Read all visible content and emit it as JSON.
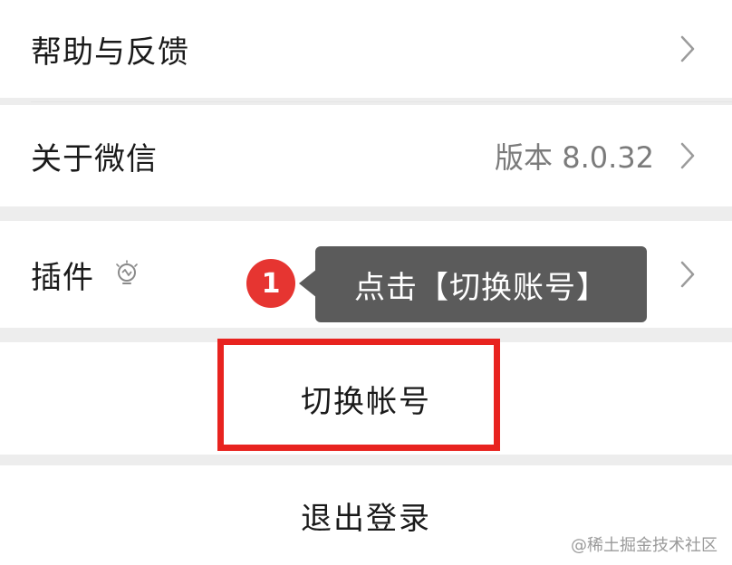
{
  "settings": {
    "help": {
      "label": "帮助与反馈"
    },
    "about": {
      "label": "关于微信",
      "version": "版本 8.0.32"
    },
    "plugins": {
      "label": "插件"
    },
    "switch_account": {
      "label": "切换帐号"
    },
    "logout": {
      "label": "退出登录"
    }
  },
  "annotation": {
    "step_number": "1",
    "tooltip": "点击【切换账号】",
    "highlight_color": "#e8231f",
    "badge_color": "#e63531"
  },
  "watermark": "@稀土掘金技术社区",
  "icons": {
    "chevron": "chevron-right-icon",
    "plugin": "lightbulb-icon"
  }
}
